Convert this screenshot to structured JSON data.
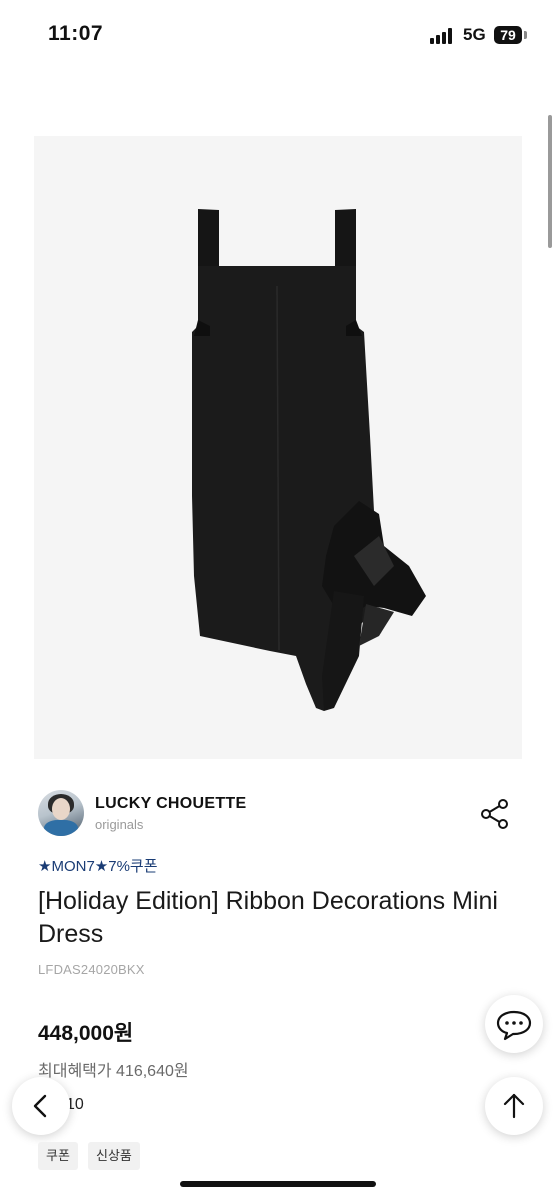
{
  "status_bar": {
    "time": "11:07",
    "network": "5G",
    "battery": "79"
  },
  "brand": {
    "name": "LUCKY CHOUETTE",
    "sub": "originals"
  },
  "product": {
    "coupon_text": "★MON7★7%쿠폰",
    "title": "[Holiday Edition] Ribbon Decorations Mini Dress",
    "code": "LFDAS24020BKX",
    "price": "448,000원",
    "benefit_price": "최대혜택가 416,640원",
    "partial_text": "10"
  },
  "tags": [
    "쿠폰",
    "신상품"
  ],
  "icons": {
    "share": "share-icon",
    "chat": "chat-icon",
    "back": "chevron-left-icon",
    "top": "arrow-up-icon"
  },
  "colors": {
    "accent_coupon": "#1a3c75",
    "product_bg": "#f5f5f5"
  }
}
